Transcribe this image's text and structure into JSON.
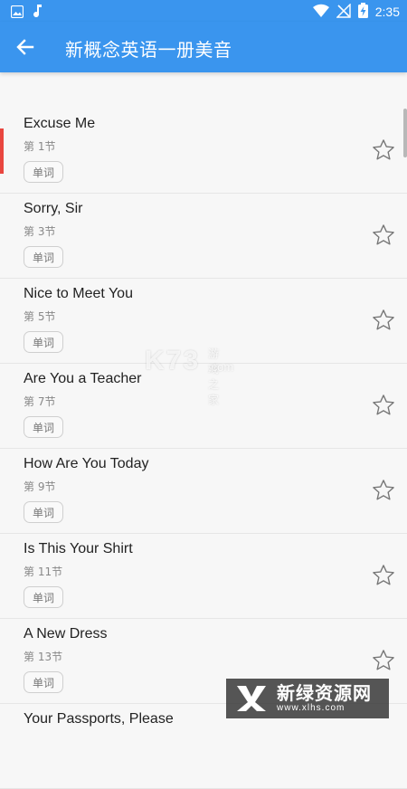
{
  "status_bar": {
    "time": "2:35",
    "icons": [
      "image-icon",
      "music-note-icon",
      "wifi-icon",
      "no-signal-icon",
      "battery-charging-icon"
    ]
  },
  "app_bar": {
    "title": "新概念英语一册美音",
    "back_icon": "back-arrow-icon"
  },
  "list": {
    "vocab_label": "单词",
    "items": [
      {
        "title": "Excuse Me",
        "subtitle": "第 1节"
      },
      {
        "title": "Sorry, Sir",
        "subtitle": "第 3节"
      },
      {
        "title": "Nice to Meet You",
        "subtitle": "第 5节"
      },
      {
        "title": "Are You a Teacher",
        "subtitle": "第 7节"
      },
      {
        "title": "How Are You Today",
        "subtitle": "第 9节"
      },
      {
        "title": "Is This Your Shirt",
        "subtitle": "第 11节"
      },
      {
        "title": "A New Dress",
        "subtitle": "第 13节"
      },
      {
        "title": "Your Passports, Please",
        "subtitle": ""
      }
    ]
  },
  "colors": {
    "primary": "#3a95ee",
    "active_indicator": "#e9463f",
    "background": "#f7f7f7"
  },
  "watermarks": {
    "center_big": "K73",
    "center_small1": "游戏之家",
    "center_small2": ".com",
    "bottom_main": "新绿资源网",
    "bottom_sub": "www.xlhs.com"
  }
}
